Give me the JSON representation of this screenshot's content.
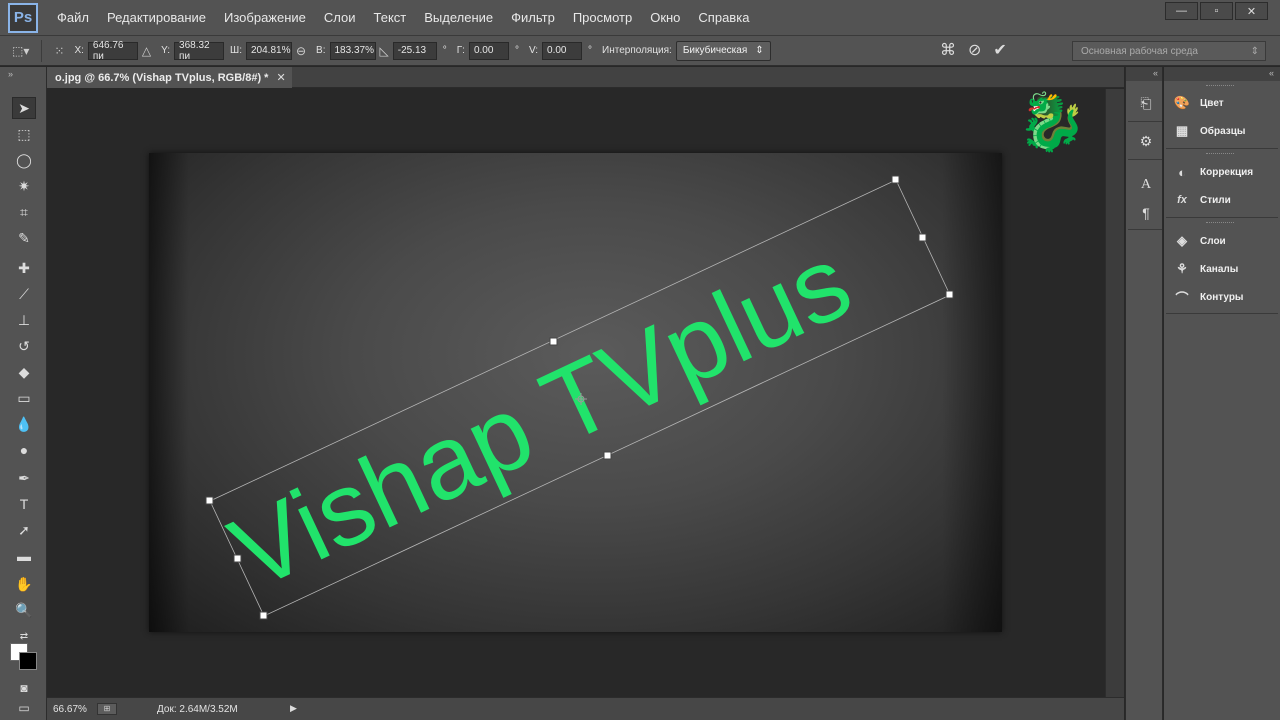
{
  "app": {
    "logo": "Ps"
  },
  "menu": [
    "Файл",
    "Редактирование",
    "Изображение",
    "Слои",
    "Текст",
    "Выделение",
    "Фильтр",
    "Просмотр",
    "Окно",
    "Справка"
  ],
  "window_controls": {
    "minimize": "—",
    "restore": "▫",
    "close": "✕"
  },
  "options": {
    "x_label": "X:",
    "x_value": "646.76 пи",
    "y_label": "Y:",
    "y_value": "368.32 пи",
    "w_label": "Ш:",
    "w_value": "204.81%",
    "h_label": "В:",
    "h_value": "183.37%",
    "angle_value": "-25.13",
    "angle_unit": "°",
    "hskew_label": "Г:",
    "hskew_value": "0.00",
    "vskew_label": "V:",
    "vskew_value": "0.00",
    "interp_label": "Интерполяция:",
    "interp_value": "Бикубическая",
    "workspace": "Основная рабочая среда"
  },
  "document": {
    "tab_title": "o.jpg @ 66.7% (Vishap TVplus, RGB/8#) *",
    "tab_close": "✕"
  },
  "canvas": {
    "text": "Vishap TVplus",
    "text_color": "#21e36b"
  },
  "status": {
    "zoom": "66.67%",
    "doc_size": "Док: 2.64M/3.52M"
  },
  "panels": {
    "items": [
      {
        "label": "Цвет",
        "icon": "palette-icon"
      },
      {
        "label": "Образцы",
        "icon": "swatches-icon"
      },
      {
        "label": "Коррекция",
        "icon": "adjustments-icon"
      },
      {
        "label": "Стили",
        "icon": "fx-styles-icon"
      },
      {
        "label": "Слои",
        "icon": "layers-icon"
      },
      {
        "label": "Каналы",
        "icon": "channels-icon"
      },
      {
        "label": "Контуры",
        "icon": "paths-icon"
      }
    ]
  },
  "colors": {
    "foreground": "#ffffff",
    "background": "#000000",
    "ui_dark": "#535353"
  }
}
